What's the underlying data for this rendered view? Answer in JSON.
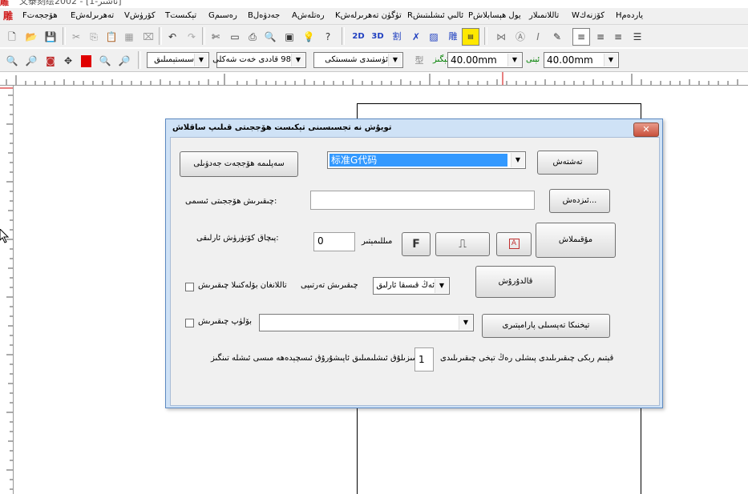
{
  "window": {
    "title": "文泰刻绘2002 - [1-ئاشىر]",
    "app_icon": "雕"
  },
  "menu": {
    "logo": "雕",
    "items": [
      "ياردەمH",
      "كۆزنەكW",
      "تاللانمىلار",
      "يول ھېسابلاشP",
      "ئالىي ئىشلىتىشR",
      "تۈگۈن تەھرىرلەشK",
      "رەتلەشA",
      "جەدۋەلB",
      "رەسىمG",
      "تېكىستT",
      "كۆرۈشV",
      "تەھرىرلەشE",
      "ھۆججەتF"
    ]
  },
  "toolbar2": {
    "view_combo": "سىستېمىلىق",
    "font_combo": "98 قاددى خەت شەكلى",
    "style_combo": "ئۈستىدى شىسىتكى",
    "width_label": "ئېگىز",
    "width_value": "40.00mm",
    "height_label": "ئېنى",
    "height_value": "40.00mm"
  },
  "dialog": {
    "title": "تويۇش نە تجسىسىنى تېكىست ھۆججىتى قىلىپ ساقلاش",
    "close_glyph": "✕",
    "export_table_button": "سەپلىمە ھۆججەت جەدۋىلى",
    "format_value": "标准G代码",
    "confirm_button": "تەشتەش",
    "save_path_label": ":چىقىرىش ھۆججىتى ئىسمى",
    "save_path_value": "",
    "browse_button": "...ئىزدەش",
    "offset_label": ":پىچاق كۆتۈرۈش ئارلىقى",
    "offset_value": "0",
    "offset_unit": "مىللىمېتىر",
    "font_btn_glyph": "F",
    "shape_btn_glyph": "⎍",
    "letter_btn_glyph": "A",
    "settings_button": "مۇقىملاش",
    "order_label": "چىقىرىش تەرتىپى",
    "order_value": "ئەڭ قىسقا ئارلىق",
    "auto_break_label": "تاللانغان بۆلەكنىلا چىقىرىش",
    "preview_button": "قالدۇرۇش",
    "split_label": "بۆلۈپ چىقىرىش",
    "split_value": "",
    "params_button": "تېخنىكا تەپسىلى پارامېتىرى",
    "count_label": "قېتىم ربكى چىقىرىلىدى پىشلى رەڭ تېخى چىقىرىلىدى",
    "count_value": "1",
    "count_suffix": "سىزىلۇق ئىشلىمىلىق ئاپىشۇرۇق ئىسچېدەھە مىسى ئىشلە تىنگىز"
  }
}
